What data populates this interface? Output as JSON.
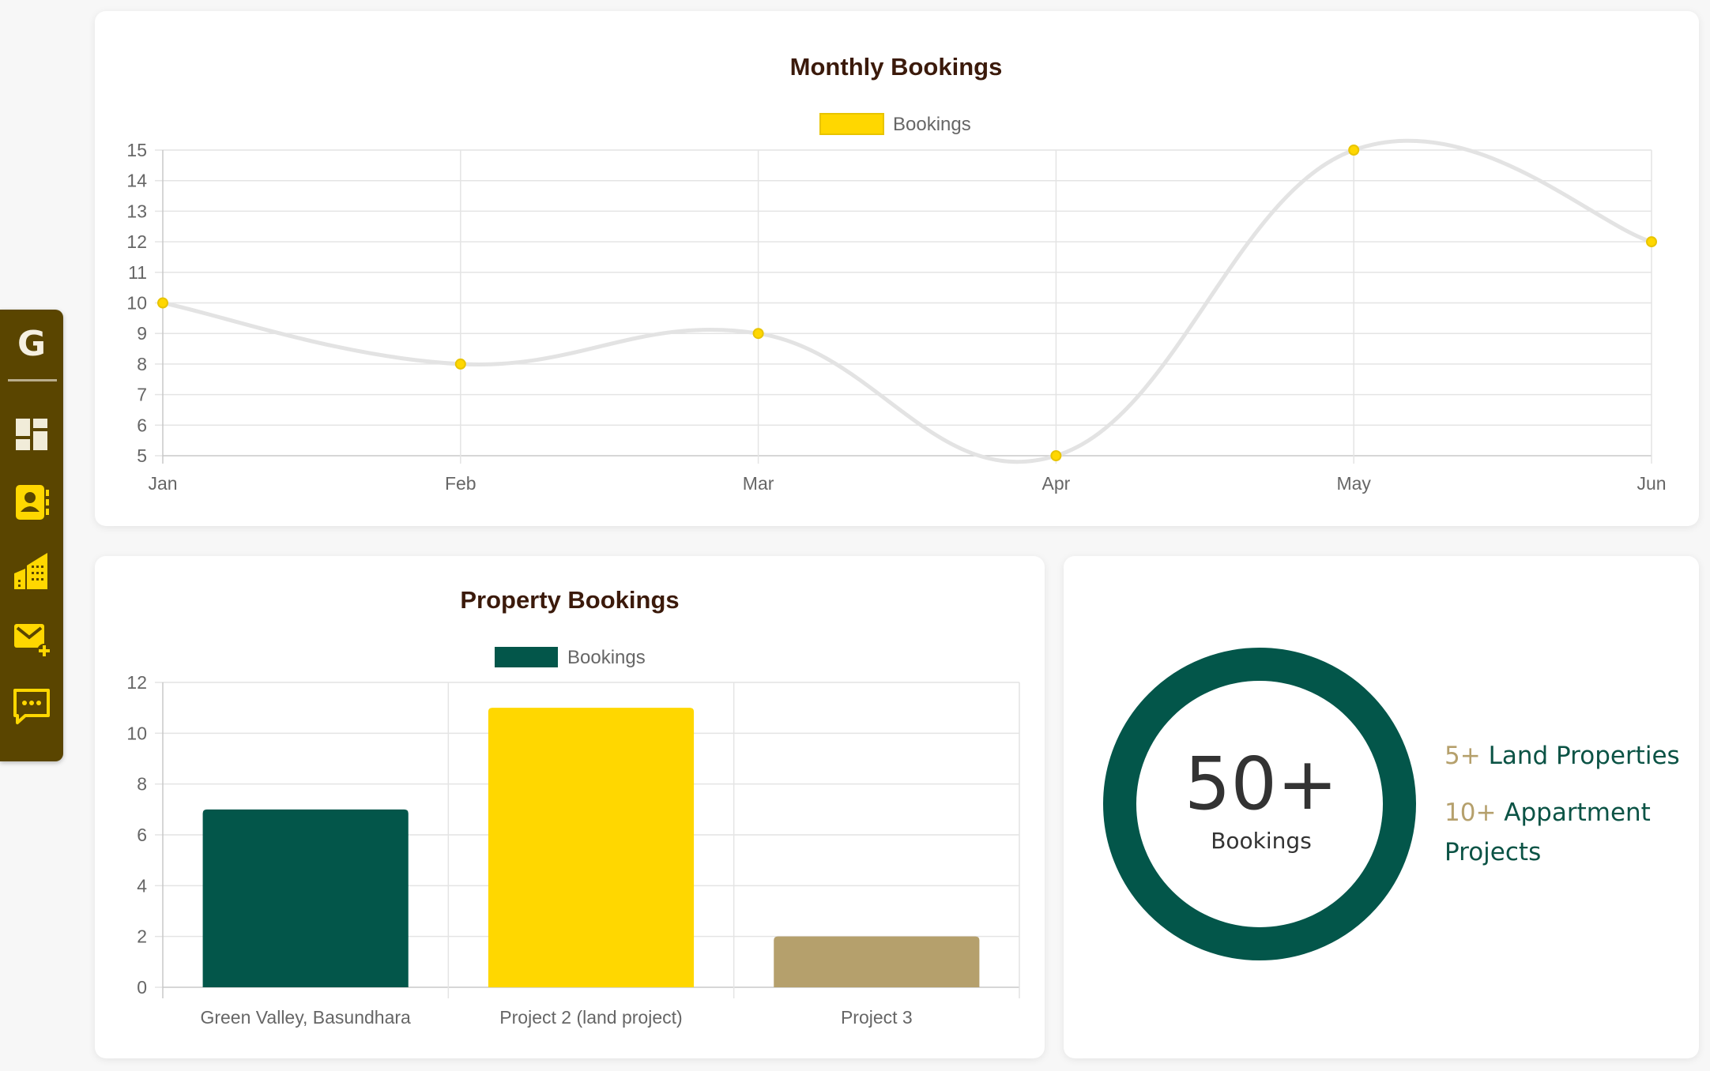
{
  "sidebar": {
    "logo": "G",
    "items": [
      {
        "icon": "dashboard-icon"
      },
      {
        "icon": "contacts-icon"
      },
      {
        "icon": "buildings-icon"
      },
      {
        "icon": "mail-add-icon"
      },
      {
        "icon": "chat-icon"
      }
    ]
  },
  "colors": {
    "sidebar_bg": "#5a4500",
    "sidebar_icon": "#ffd700",
    "accent_green": "#03564a",
    "accent_yellow": "#ffd700",
    "accent_tan": "#b5a06c",
    "title_text": "#3b1a0b"
  },
  "chart_data": [
    {
      "type": "line",
      "title": "Monthly Bookings",
      "categories": [
        "Jan",
        "Feb",
        "Mar",
        "Apr",
        "May",
        "Jun"
      ],
      "series": [
        {
          "name": "Bookings",
          "values": [
            10,
            8,
            9,
            5,
            15,
            12
          ],
          "color": "#ffd700",
          "line_color": "#e3e3e3"
        }
      ],
      "ylim": [
        5,
        15
      ],
      "yticks": [
        5,
        6,
        7,
        8,
        9,
        10,
        11,
        12,
        13,
        14,
        15
      ],
      "grid": true,
      "legend": "top-center"
    },
    {
      "type": "bar",
      "title": "Property Bookings",
      "categories": [
        "Green Valley, Basundhara",
        "Project 2 (land project)",
        "Project 3"
      ],
      "series": [
        {
          "name": "Bookings",
          "values": [
            7,
            11,
            2
          ],
          "colors": [
            "#03564a",
            "#ffd700",
            "#b5a06c"
          ]
        }
      ],
      "ylim": [
        0,
        12
      ],
      "yticks": [
        0,
        2,
        4,
        6,
        8,
        10,
        12
      ],
      "grid": true,
      "legend": "top-center"
    }
  ],
  "stats": {
    "total": "50+",
    "total_label": "Bookings",
    "facts": [
      {
        "num": "5+",
        "label": "Land Properties"
      },
      {
        "num": "10+",
        "label": "Appartment Projects"
      }
    ]
  }
}
